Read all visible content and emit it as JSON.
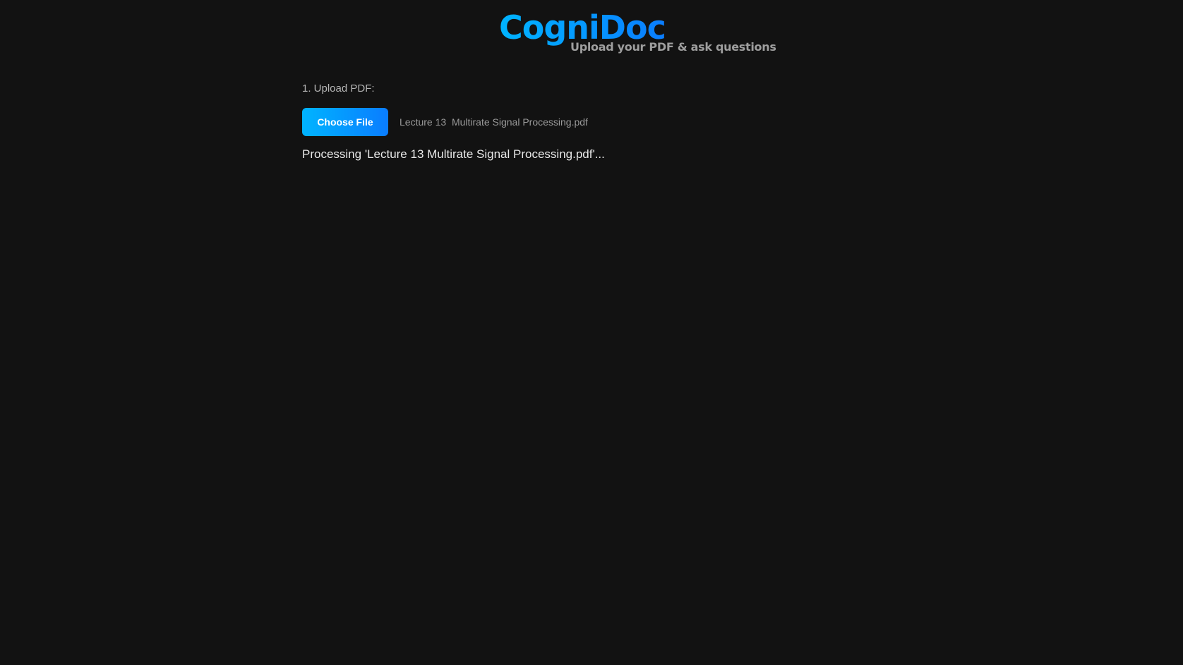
{
  "header": {
    "title": "CogniDoc",
    "subtitle": "Upload your PDF & ask questions"
  },
  "upload": {
    "step_label": "1. Upload PDF:",
    "button_label": "Choose File",
    "file_name": "Lecture 13  Multirate Signal Processing.pdf"
  },
  "status": {
    "message": "Processing 'Lecture 13 Multirate Signal Processing.pdf'..."
  },
  "colors": {
    "background": "#121212",
    "accent_start": "#00b4ff",
    "accent_end": "#0a7dff",
    "subtitle": "#9e9e9e"
  }
}
